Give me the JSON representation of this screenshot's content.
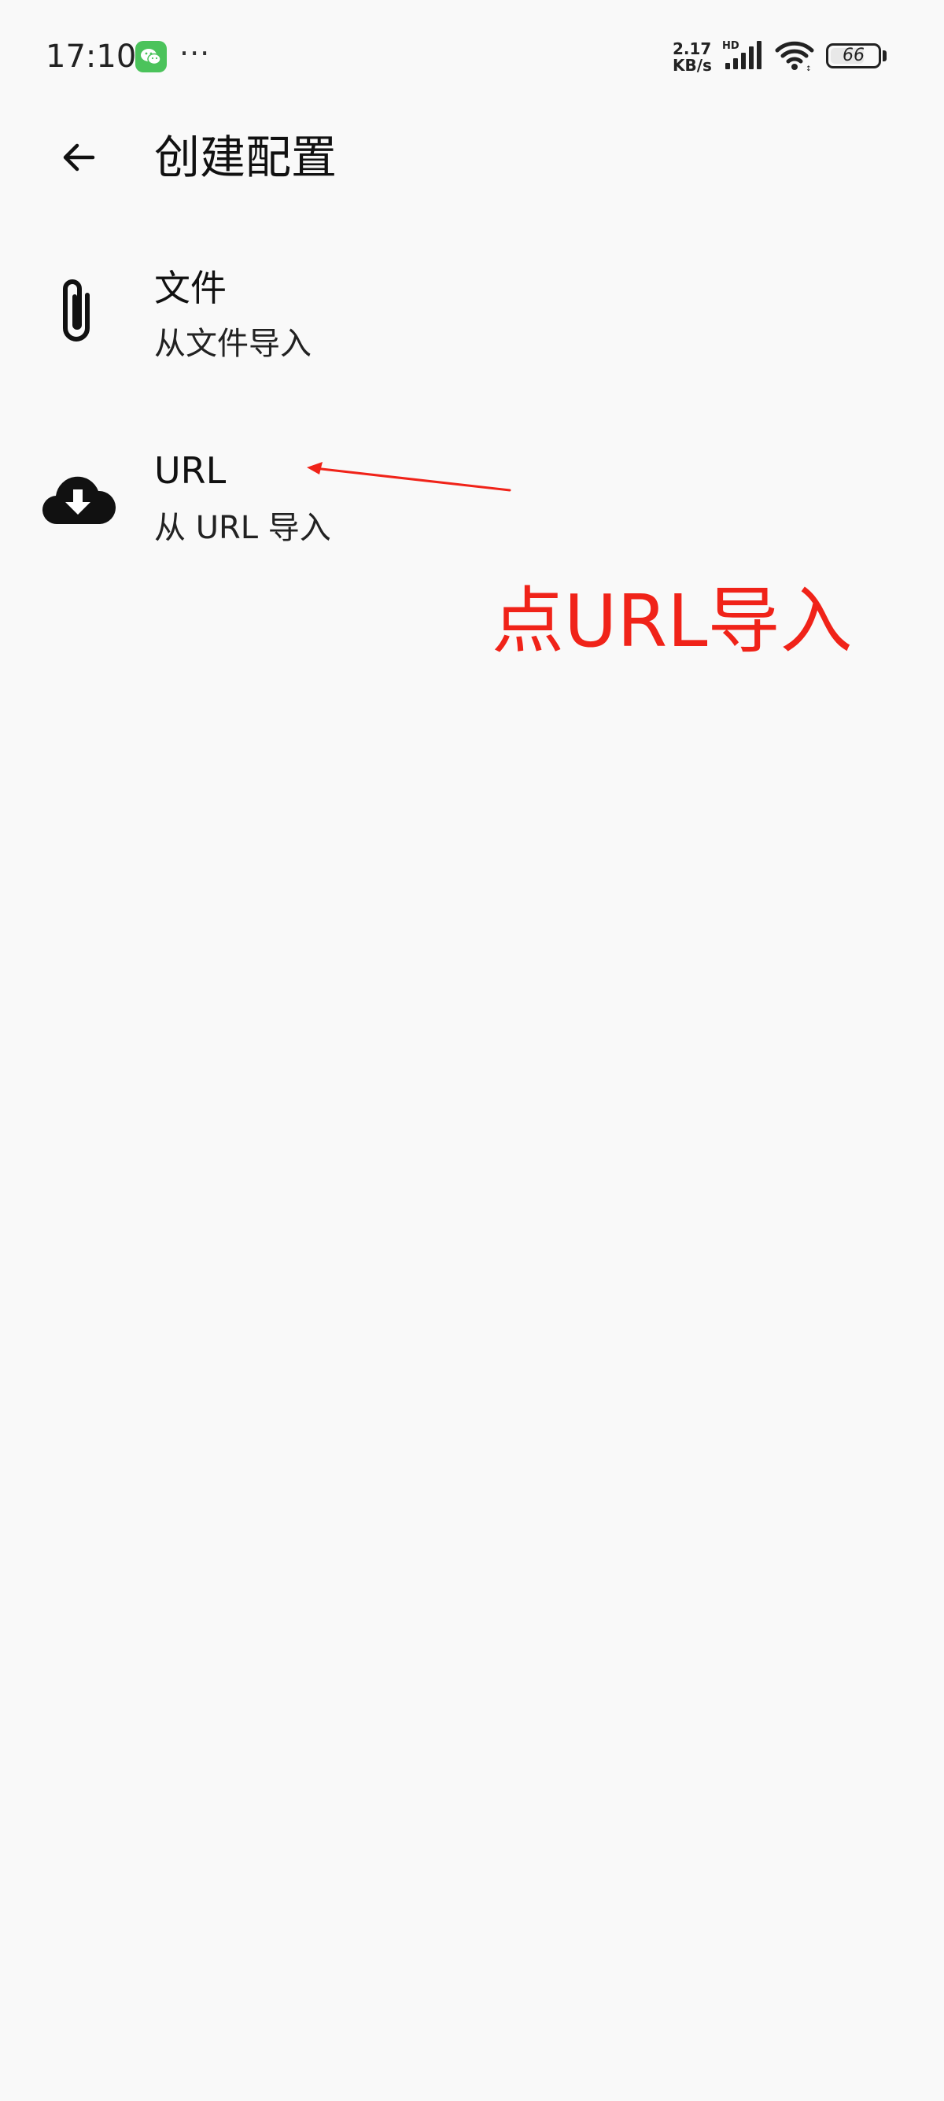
{
  "status_bar": {
    "time": "17:10",
    "notification_icons": [
      "wechat-icon"
    ],
    "more_indicator": "···",
    "net_speed_value": "2.17",
    "net_speed_unit": "KB/s",
    "signal_label": "HD",
    "battery_level": "66"
  },
  "app_bar": {
    "back_icon": "arrow-left-icon",
    "title": "创建配置"
  },
  "list": {
    "items": [
      {
        "icon": "paperclip-icon",
        "title": "文件",
        "subtitle": "从文件导入"
      },
      {
        "icon": "cloud-download-icon",
        "title": "URL",
        "subtitle": "从 URL 导入"
      }
    ]
  },
  "annotation": {
    "text": "点URL导入",
    "color": "#f02319"
  },
  "colors": {
    "background": "#f9f9f9",
    "text_primary": "#111111",
    "wechat_green": "#4bc35b",
    "annotation_red": "#f02319"
  }
}
